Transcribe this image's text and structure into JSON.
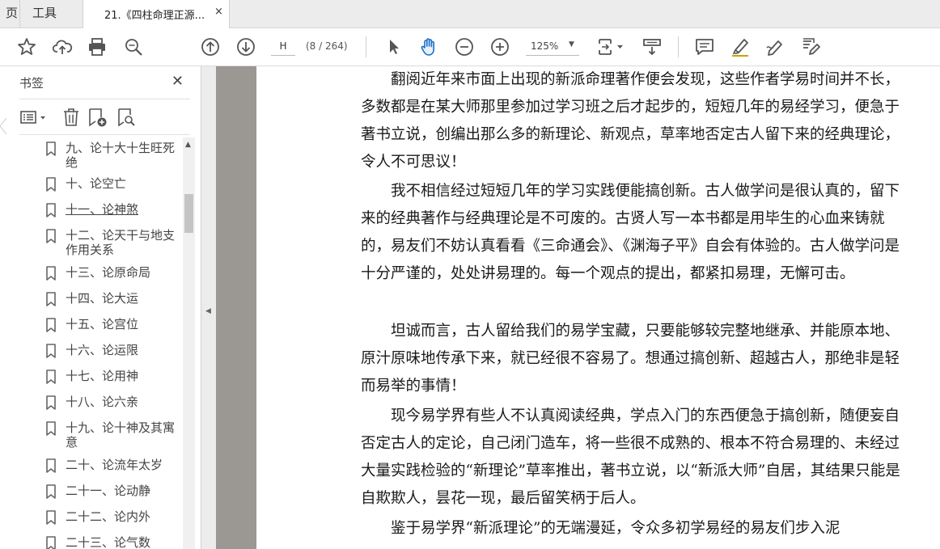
{
  "tabs": {
    "home_label": "页",
    "tools_label": "工具",
    "doc_title": "21.《四柱命理正源...",
    "close_glyph": "×"
  },
  "toolbar": {
    "page_input_value": "H",
    "page_count": "(8 / 264)",
    "zoom_value": "125%",
    "icons": [
      "star-icon",
      "cloud-upload-icon",
      "print-icon",
      "zoom-search-icon",
      "page-up-icon",
      "page-down-icon",
      "select-arrow-icon",
      "hand-icon",
      "zoom-out-icon",
      "zoom-in-icon",
      "fit-page-icon",
      "scroll-mode-icon",
      "comment-icon",
      "highlight-icon",
      "sign-icon",
      "edit-icon"
    ]
  },
  "sidebar": {
    "title": "书签",
    "close_glyph": "✕",
    "bookmarks": [
      {
        "label": "九、论十大十生旺死绝",
        "underline": false
      },
      {
        "label": "十、论空亡",
        "underline": false
      },
      {
        "label": "十一、论神煞",
        "underline": true
      },
      {
        "label": "十二、论天干与地支作用关系",
        "underline": false
      },
      {
        "label": "十三、论原命局",
        "underline": false
      },
      {
        "label": "十四、论大运",
        "underline": false
      },
      {
        "label": "十五、论宫位",
        "underline": false
      },
      {
        "label": "十六、论运限",
        "underline": false
      },
      {
        "label": "十七、论用神",
        "underline": false
      },
      {
        "label": "十八、论六亲",
        "underline": false
      },
      {
        "label": "十九、论十神及其寓意",
        "underline": false
      },
      {
        "label": "二十、论流年太岁",
        "underline": false
      },
      {
        "label": "二十一、论动静",
        "underline": false
      },
      {
        "label": "二十二、论内外",
        "underline": false
      },
      {
        "label": "二十三、论气数",
        "underline": false
      }
    ]
  },
  "document": {
    "paragraphs": [
      "　　翻阅近年来市面上出现的新派命理著作便会发现，这些作者学易时间并不长，多数都是在某大师那里参加过学习班之后才起步的，短短几年的易经学习，便急于著书立说，创编出那么多的新理论、新观点，草率地否定古人留下来的经典理论，令人不可思议！",
      "　　我不相信经过短短几年的学习实践便能搞创新。古人做学问是很认真的，留下来的经典著作与经典理论是不可废的。古贤人写一本书都是用毕生的心血来铸就的，易友们不妨认真看看《三命通会》、《渊海子平》自会有体验的。古人做学问是十分严谨的，处处讲易理的。每一个观点的提出，都紧扣易理，无懈可击。",
      "　　坦诚而言，古人留给我们的易学宝藏，只要能够较完整地继承、并能原本地、原汁原味地传承下来，就已经很不容易了。想通过搞创新、超越古人，那绝非是轻而易举的事情！",
      "　　现今易学界有些人不认真阅读经典，学点入门的东西便急于搞创新，随便妄自否定古人的定论，自己闭门造车，将一些很不成熟的、根本不符合易理的、未经过大量实践检验的“新理论”草率推出，著书立说，以“新派大师”自居，其结果只能是自欺欺人，昙花一现，最后留笑柄于后人。",
      "　　鉴于易学界“新派理论”的无端漫延，令众多初学易经的易友们步入泥"
    ]
  }
}
